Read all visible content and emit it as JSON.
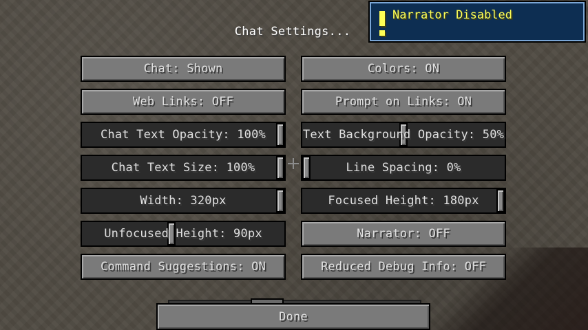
{
  "screen": {
    "title": "Chat Settings..."
  },
  "toast": {
    "text": "Narrator Disabled",
    "icon": "exclamation-icon"
  },
  "options": {
    "chat": {
      "label": "Chat: Shown"
    },
    "colors": {
      "label": "Colors: ON"
    },
    "web_links": {
      "label": "Web Links: OFF"
    },
    "prompt_on_links": {
      "label": "Prompt on Links: ON"
    },
    "chat_text_opacity": {
      "label": "Chat Text Opacity: 100%",
      "value": 1.0
    },
    "text_background_opacity": {
      "label": "Text Background Opacity: 50%",
      "value": 0.5
    },
    "chat_text_size": {
      "label": "Chat Text Size: 100%",
      "value": 1.0
    },
    "line_spacing": {
      "label": "Line Spacing: 0%",
      "value": 0.0
    },
    "width": {
      "label": "Width: 320px",
      "value": 1.0
    },
    "focused_height": {
      "label": "Focused Height: 180px",
      "value": 1.0
    },
    "unfocused_height": {
      "label": "Unfocused Height: 90px",
      "value": 0.44
    },
    "narrator": {
      "label": "Narrator: OFF"
    },
    "command_suggestions": {
      "label": "Command Suggestions: ON"
    },
    "reduced_debug_info": {
      "label": "Reduced Debug Info: OFF"
    }
  },
  "done": {
    "label": "Done"
  },
  "colors": {
    "toast_text": "#ffff55",
    "toast_bg": "#0d2e52",
    "button": "#7a7a7a",
    "slider_track": "#2b2b2b"
  }
}
